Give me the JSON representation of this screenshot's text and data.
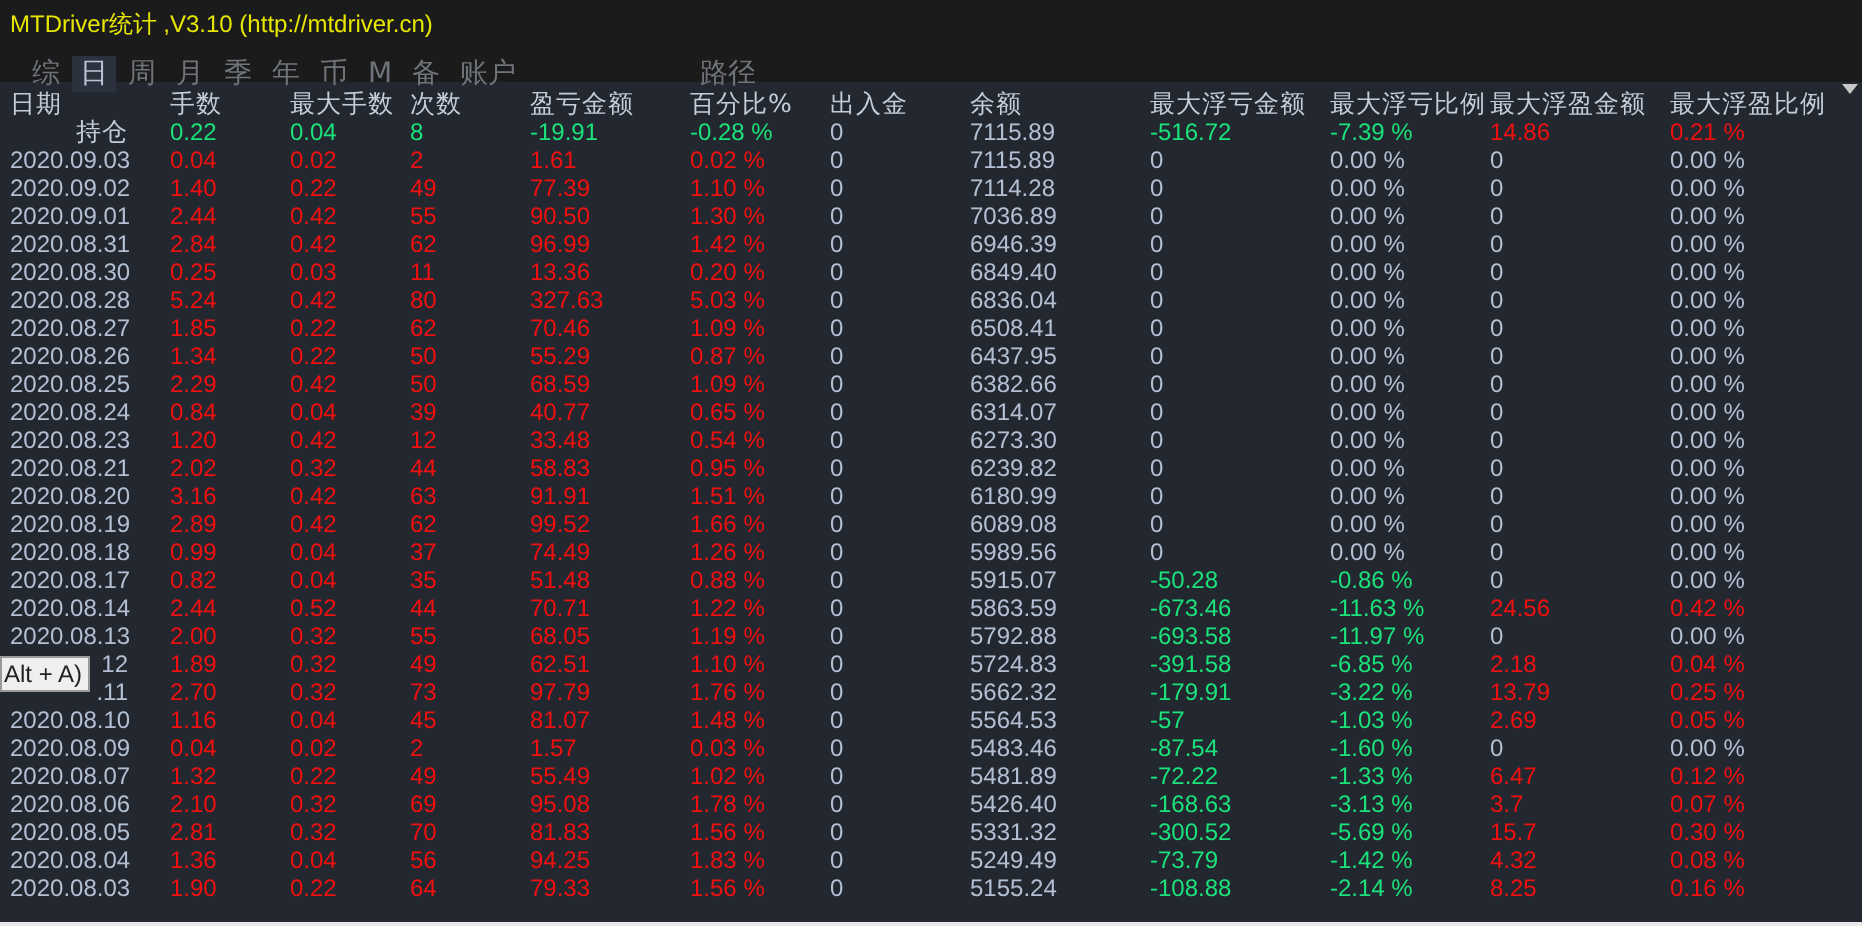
{
  "window": {
    "title": "MTDriver统计 ,V3.10 (http://mtdriver.cn)"
  },
  "tabs": [
    {
      "label": "综",
      "selected": false
    },
    {
      "label": "日",
      "selected": true
    },
    {
      "label": "周",
      "selected": false
    },
    {
      "label": "月",
      "selected": false
    },
    {
      "label": "季",
      "selected": false
    },
    {
      "label": "年",
      "selected": false
    },
    {
      "label": "币",
      "selected": false
    },
    {
      "label": "M",
      "selected": false
    },
    {
      "label": "备",
      "selected": false
    },
    {
      "label": "账户",
      "selected": false
    },
    {
      "label": "路径",
      "selected": false
    }
  ],
  "table": {
    "columns": [
      "日期",
      "手数",
      "最大手数",
      "次数",
      "盈亏金额",
      "百分比%",
      "出入金",
      "余额",
      "最大浮亏金额",
      "最大浮亏比例",
      "最大浮盈金额",
      "最大浮盈比例"
    ],
    "rows": [
      {
        "cells": [
          {
            "text": "持仓"
          },
          {
            "text": "0.22",
            "color": "#1be27a"
          },
          {
            "text": "0.04",
            "color": "#1be27a"
          },
          {
            "text": "8",
            "color": "#1be27a"
          },
          {
            "text": "-19.91",
            "color": "#1be27a"
          },
          {
            "text": "-0.28 %",
            "color": "#1be27a"
          },
          {
            "text": "0"
          },
          {
            "text": "7115.89"
          },
          {
            "text": "-516.72",
            "color": "#1be27a"
          },
          {
            "text": "-7.39 %",
            "color": "#1be27a"
          },
          {
            "text": "14.86",
            "color": "#f01010"
          },
          {
            "text": "0.21 %",
            "color": "#f01010"
          }
        ]
      },
      {
        "cells": [
          {
            "text": "2020.09.03"
          },
          {
            "text": "0.04",
            "color": "#f01010"
          },
          {
            "text": "0.02",
            "color": "#f01010"
          },
          {
            "text": "2",
            "color": "#f01010"
          },
          {
            "text": "1.61",
            "color": "#f01010"
          },
          {
            "text": "0.02 %",
            "color": "#f01010"
          },
          {
            "text": "0"
          },
          {
            "text": "7115.89"
          },
          {
            "text": "0"
          },
          {
            "text": "0.00 %"
          },
          {
            "text": "0"
          },
          {
            "text": "0.00 %"
          }
        ]
      },
      {
        "cells": [
          {
            "text": "2020.09.02"
          },
          {
            "text": "1.40",
            "color": "#f01010"
          },
          {
            "text": "0.22",
            "color": "#f01010"
          },
          {
            "text": "49",
            "color": "#f01010"
          },
          {
            "text": "77.39",
            "color": "#f01010"
          },
          {
            "text": "1.10 %",
            "color": "#f01010"
          },
          {
            "text": "0"
          },
          {
            "text": "7114.28"
          },
          {
            "text": "0"
          },
          {
            "text": "0.00 %"
          },
          {
            "text": "0"
          },
          {
            "text": "0.00 %"
          }
        ]
      },
      {
        "cells": [
          {
            "text": "2020.09.01"
          },
          {
            "text": "2.44",
            "color": "#f01010"
          },
          {
            "text": "0.42",
            "color": "#f01010"
          },
          {
            "text": "55",
            "color": "#f01010"
          },
          {
            "text": "90.50",
            "color": "#f01010"
          },
          {
            "text": "1.30 %",
            "color": "#f01010"
          },
          {
            "text": "0"
          },
          {
            "text": "7036.89"
          },
          {
            "text": "0"
          },
          {
            "text": "0.00 %"
          },
          {
            "text": "0"
          },
          {
            "text": "0.00 %"
          }
        ]
      },
      {
        "cells": [
          {
            "text": "2020.08.31"
          },
          {
            "text": "2.84",
            "color": "#f01010"
          },
          {
            "text": "0.42",
            "color": "#f01010"
          },
          {
            "text": "62",
            "color": "#f01010"
          },
          {
            "text": "96.99",
            "color": "#f01010"
          },
          {
            "text": "1.42 %",
            "color": "#f01010"
          },
          {
            "text": "0"
          },
          {
            "text": "6946.39"
          },
          {
            "text": "0"
          },
          {
            "text": "0.00 %"
          },
          {
            "text": "0"
          },
          {
            "text": "0.00 %"
          }
        ]
      },
      {
        "cells": [
          {
            "text": "2020.08.30"
          },
          {
            "text": "0.25",
            "color": "#f01010"
          },
          {
            "text": "0.03",
            "color": "#f01010"
          },
          {
            "text": "11",
            "color": "#f01010"
          },
          {
            "text": "13.36",
            "color": "#f01010"
          },
          {
            "text": "0.20 %",
            "color": "#f01010"
          },
          {
            "text": "0"
          },
          {
            "text": "6849.40"
          },
          {
            "text": "0"
          },
          {
            "text": "0.00 %"
          },
          {
            "text": "0"
          },
          {
            "text": "0.00 %"
          }
        ]
      },
      {
        "cells": [
          {
            "text": "2020.08.28"
          },
          {
            "text": "5.24",
            "color": "#f01010"
          },
          {
            "text": "0.42",
            "color": "#f01010"
          },
          {
            "text": "80",
            "color": "#f01010"
          },
          {
            "text": "327.63",
            "color": "#f01010"
          },
          {
            "text": "5.03 %",
            "color": "#f01010"
          },
          {
            "text": "0"
          },
          {
            "text": "6836.04"
          },
          {
            "text": "0"
          },
          {
            "text": "0.00 %"
          },
          {
            "text": "0"
          },
          {
            "text": "0.00 %"
          }
        ]
      },
      {
        "cells": [
          {
            "text": "2020.08.27"
          },
          {
            "text": "1.85",
            "color": "#f01010"
          },
          {
            "text": "0.22",
            "color": "#f01010"
          },
          {
            "text": "62",
            "color": "#f01010"
          },
          {
            "text": "70.46",
            "color": "#f01010"
          },
          {
            "text": "1.09 %",
            "color": "#f01010"
          },
          {
            "text": "0"
          },
          {
            "text": "6508.41"
          },
          {
            "text": "0"
          },
          {
            "text": "0.00 %"
          },
          {
            "text": "0"
          },
          {
            "text": "0.00 %"
          }
        ]
      },
      {
        "cells": [
          {
            "text": "2020.08.26"
          },
          {
            "text": "1.34",
            "color": "#f01010"
          },
          {
            "text": "0.22",
            "color": "#f01010"
          },
          {
            "text": "50",
            "color": "#f01010"
          },
          {
            "text": "55.29",
            "color": "#f01010"
          },
          {
            "text": "0.87 %",
            "color": "#f01010"
          },
          {
            "text": "0"
          },
          {
            "text": "6437.95"
          },
          {
            "text": "0"
          },
          {
            "text": "0.00 %"
          },
          {
            "text": "0"
          },
          {
            "text": "0.00 %"
          }
        ]
      },
      {
        "cells": [
          {
            "text": "2020.08.25"
          },
          {
            "text": "2.29",
            "color": "#f01010"
          },
          {
            "text": "0.42",
            "color": "#f01010"
          },
          {
            "text": "50",
            "color": "#f01010"
          },
          {
            "text": "68.59",
            "color": "#f01010"
          },
          {
            "text": "1.09 %",
            "color": "#f01010"
          },
          {
            "text": "0"
          },
          {
            "text": "6382.66"
          },
          {
            "text": "0"
          },
          {
            "text": "0.00 %"
          },
          {
            "text": "0"
          },
          {
            "text": "0.00 %"
          }
        ]
      },
      {
        "cells": [
          {
            "text": "2020.08.24"
          },
          {
            "text": "0.84",
            "color": "#f01010"
          },
          {
            "text": "0.04",
            "color": "#f01010"
          },
          {
            "text": "39",
            "color": "#f01010"
          },
          {
            "text": "40.77",
            "color": "#f01010"
          },
          {
            "text": "0.65 %",
            "color": "#f01010"
          },
          {
            "text": "0"
          },
          {
            "text": "6314.07"
          },
          {
            "text": "0"
          },
          {
            "text": "0.00 %"
          },
          {
            "text": "0"
          },
          {
            "text": "0.00 %"
          }
        ]
      },
      {
        "cells": [
          {
            "text": "2020.08.23"
          },
          {
            "text": "1.20",
            "color": "#f01010"
          },
          {
            "text": "0.42",
            "color": "#f01010"
          },
          {
            "text": "12",
            "color": "#f01010"
          },
          {
            "text": "33.48",
            "color": "#f01010"
          },
          {
            "text": "0.54 %",
            "color": "#f01010"
          },
          {
            "text": "0"
          },
          {
            "text": "6273.30"
          },
          {
            "text": "0"
          },
          {
            "text": "0.00 %"
          },
          {
            "text": "0"
          },
          {
            "text": "0.00 %"
          }
        ]
      },
      {
        "cells": [
          {
            "text": "2020.08.21"
          },
          {
            "text": "2.02",
            "color": "#f01010"
          },
          {
            "text": "0.32",
            "color": "#f01010"
          },
          {
            "text": "44",
            "color": "#f01010"
          },
          {
            "text": "58.83",
            "color": "#f01010"
          },
          {
            "text": "0.95 %",
            "color": "#f01010"
          },
          {
            "text": "0"
          },
          {
            "text": "6239.82"
          },
          {
            "text": "0"
          },
          {
            "text": "0.00 %"
          },
          {
            "text": "0"
          },
          {
            "text": "0.00 %"
          }
        ]
      },
      {
        "cells": [
          {
            "text": "2020.08.20"
          },
          {
            "text": "3.16",
            "color": "#f01010"
          },
          {
            "text": "0.42",
            "color": "#f01010"
          },
          {
            "text": "63",
            "color": "#f01010"
          },
          {
            "text": "91.91",
            "color": "#f01010"
          },
          {
            "text": "1.51 %",
            "color": "#f01010"
          },
          {
            "text": "0"
          },
          {
            "text": "6180.99"
          },
          {
            "text": "0"
          },
          {
            "text": "0.00 %"
          },
          {
            "text": "0"
          },
          {
            "text": "0.00 %"
          }
        ]
      },
      {
        "cells": [
          {
            "text": "2020.08.19"
          },
          {
            "text": "2.89",
            "color": "#f01010"
          },
          {
            "text": "0.42",
            "color": "#f01010"
          },
          {
            "text": "62",
            "color": "#f01010"
          },
          {
            "text": "99.52",
            "color": "#f01010"
          },
          {
            "text": "1.66 %",
            "color": "#f01010"
          },
          {
            "text": "0"
          },
          {
            "text": "6089.08"
          },
          {
            "text": "0"
          },
          {
            "text": "0.00 %"
          },
          {
            "text": "0"
          },
          {
            "text": "0.00 %"
          }
        ]
      },
      {
        "cells": [
          {
            "text": "2020.08.18"
          },
          {
            "text": "0.99",
            "color": "#f01010"
          },
          {
            "text": "0.04",
            "color": "#f01010"
          },
          {
            "text": "37",
            "color": "#f01010"
          },
          {
            "text": "74.49",
            "color": "#f01010"
          },
          {
            "text": "1.26 %",
            "color": "#f01010"
          },
          {
            "text": "0"
          },
          {
            "text": "5989.56"
          },
          {
            "text": "0"
          },
          {
            "text": "0.00 %"
          },
          {
            "text": "0"
          },
          {
            "text": "0.00 %"
          }
        ]
      },
      {
        "cells": [
          {
            "text": "2020.08.17"
          },
          {
            "text": "0.82",
            "color": "#f01010"
          },
          {
            "text": "0.04",
            "color": "#f01010"
          },
          {
            "text": "35",
            "color": "#f01010"
          },
          {
            "text": "51.48",
            "color": "#f01010"
          },
          {
            "text": "0.88 %",
            "color": "#f01010"
          },
          {
            "text": "0"
          },
          {
            "text": "5915.07"
          },
          {
            "text": "-50.28",
            "color": "#1be27a"
          },
          {
            "text": "-0.86 %",
            "color": "#1be27a"
          },
          {
            "text": "0"
          },
          {
            "text": "0.00 %"
          }
        ]
      },
      {
        "cells": [
          {
            "text": "2020.08.14"
          },
          {
            "text": "2.44",
            "color": "#f01010"
          },
          {
            "text": "0.52",
            "color": "#f01010"
          },
          {
            "text": "44",
            "color": "#f01010"
          },
          {
            "text": "70.71",
            "color": "#f01010"
          },
          {
            "text": "1.22 %",
            "color": "#f01010"
          },
          {
            "text": "0"
          },
          {
            "text": "5863.59"
          },
          {
            "text": "-673.46",
            "color": "#1be27a"
          },
          {
            "text": "-11.63 %",
            "color": "#1be27a"
          },
          {
            "text": "24.56",
            "color": "#f01010"
          },
          {
            "text": "0.42 %",
            "color": "#f01010"
          }
        ]
      },
      {
        "cells": [
          {
            "text": "2020.08.13"
          },
          {
            "text": "2.00",
            "color": "#f01010"
          },
          {
            "text": "0.32",
            "color": "#f01010"
          },
          {
            "text": "55",
            "color": "#f01010"
          },
          {
            "text": "68.05",
            "color": "#f01010"
          },
          {
            "text": "1.19 %",
            "color": "#f01010"
          },
          {
            "text": "0"
          },
          {
            "text": "5792.88"
          },
          {
            "text": "-693.58",
            "color": "#1be27a"
          },
          {
            "text": "-11.97 %",
            "color": "#1be27a"
          },
          {
            "text": "0"
          },
          {
            "text": "0.00 %"
          }
        ]
      },
      {
        "cells": [
          {
            "text": "12"
          },
          {
            "text": "1.89",
            "color": "#f01010"
          },
          {
            "text": "0.32",
            "color": "#f01010"
          },
          {
            "text": "49",
            "color": "#f01010"
          },
          {
            "text": "62.51",
            "color": "#f01010"
          },
          {
            "text": "1.10 %",
            "color": "#f01010"
          },
          {
            "text": "0"
          },
          {
            "text": "5724.83"
          },
          {
            "text": "-391.58",
            "color": "#1be27a"
          },
          {
            "text": "-6.85 %",
            "color": "#1be27a"
          },
          {
            "text": "2.18",
            "color": "#f01010"
          },
          {
            "text": "0.04 %",
            "color": "#f01010"
          }
        ]
      },
      {
        "cells": [
          {
            "text": ".11"
          },
          {
            "text": "2.70",
            "color": "#f01010"
          },
          {
            "text": "0.32",
            "color": "#f01010"
          },
          {
            "text": "73",
            "color": "#f01010"
          },
          {
            "text": "97.79",
            "color": "#f01010"
          },
          {
            "text": "1.76 %",
            "color": "#f01010"
          },
          {
            "text": "0"
          },
          {
            "text": "5662.32"
          },
          {
            "text": "-179.91",
            "color": "#1be27a"
          },
          {
            "text": "-3.22 %",
            "color": "#1be27a"
          },
          {
            "text": "13.79",
            "color": "#f01010"
          },
          {
            "text": "0.25 %",
            "color": "#f01010"
          }
        ]
      },
      {
        "cells": [
          {
            "text": "2020.08.10"
          },
          {
            "text": "1.16",
            "color": "#f01010"
          },
          {
            "text": "0.04",
            "color": "#f01010"
          },
          {
            "text": "45",
            "color": "#f01010"
          },
          {
            "text": "81.07",
            "color": "#f01010"
          },
          {
            "text": "1.48 %",
            "color": "#f01010"
          },
          {
            "text": "0"
          },
          {
            "text": "5564.53"
          },
          {
            "text": "-57",
            "color": "#1be27a"
          },
          {
            "text": "-1.03 %",
            "color": "#1be27a"
          },
          {
            "text": "2.69",
            "color": "#f01010"
          },
          {
            "text": "0.05 %",
            "color": "#f01010"
          }
        ]
      },
      {
        "cells": [
          {
            "text": "2020.08.09"
          },
          {
            "text": "0.04",
            "color": "#f01010"
          },
          {
            "text": "0.02",
            "color": "#f01010"
          },
          {
            "text": "2",
            "color": "#f01010"
          },
          {
            "text": "1.57",
            "color": "#f01010"
          },
          {
            "text": "0.03 %",
            "color": "#f01010"
          },
          {
            "text": "0"
          },
          {
            "text": "5483.46"
          },
          {
            "text": "-87.54",
            "color": "#1be27a"
          },
          {
            "text": "-1.60 %",
            "color": "#1be27a"
          },
          {
            "text": "0"
          },
          {
            "text": "0.00 %"
          }
        ]
      },
      {
        "cells": [
          {
            "text": "2020.08.07"
          },
          {
            "text": "1.32",
            "color": "#f01010"
          },
          {
            "text": "0.22",
            "color": "#f01010"
          },
          {
            "text": "49",
            "color": "#f01010"
          },
          {
            "text": "55.49",
            "color": "#f01010"
          },
          {
            "text": "1.02 %",
            "color": "#f01010"
          },
          {
            "text": "0"
          },
          {
            "text": "5481.89"
          },
          {
            "text": "-72.22",
            "color": "#1be27a"
          },
          {
            "text": "-1.33 %",
            "color": "#1be27a"
          },
          {
            "text": "6.47",
            "color": "#f01010"
          },
          {
            "text": "0.12 %",
            "color": "#f01010"
          }
        ]
      },
      {
        "cells": [
          {
            "text": "2020.08.06"
          },
          {
            "text": "2.10",
            "color": "#f01010"
          },
          {
            "text": "0.32",
            "color": "#f01010"
          },
          {
            "text": "69",
            "color": "#f01010"
          },
          {
            "text": "95.08",
            "color": "#f01010"
          },
          {
            "text": "1.78 %",
            "color": "#f01010"
          },
          {
            "text": "0"
          },
          {
            "text": "5426.40"
          },
          {
            "text": "-168.63",
            "color": "#1be27a"
          },
          {
            "text": "-3.13 %",
            "color": "#1be27a"
          },
          {
            "text": "3.7",
            "color": "#f01010"
          },
          {
            "text": "0.07 %",
            "color": "#f01010"
          }
        ]
      },
      {
        "cells": [
          {
            "text": "2020.08.05"
          },
          {
            "text": "2.81",
            "color": "#f01010"
          },
          {
            "text": "0.32",
            "color": "#f01010"
          },
          {
            "text": "70",
            "color": "#f01010"
          },
          {
            "text": "81.83",
            "color": "#f01010"
          },
          {
            "text": "1.56 %",
            "color": "#f01010"
          },
          {
            "text": "0"
          },
          {
            "text": "5331.32"
          },
          {
            "text": "-300.52",
            "color": "#1be27a"
          },
          {
            "text": "-5.69 %",
            "color": "#1be27a"
          },
          {
            "text": "15.7",
            "color": "#f01010"
          },
          {
            "text": "0.30 %",
            "color": "#f01010"
          }
        ]
      },
      {
        "cells": [
          {
            "text": "2020.08.04"
          },
          {
            "text": "1.36",
            "color": "#f01010"
          },
          {
            "text": "0.04",
            "color": "#f01010"
          },
          {
            "text": "56",
            "color": "#f01010"
          },
          {
            "text": "94.25",
            "color": "#f01010"
          },
          {
            "text": "1.83 %",
            "color": "#f01010"
          },
          {
            "text": "0"
          },
          {
            "text": "5249.49"
          },
          {
            "text": "-73.79",
            "color": "#1be27a"
          },
          {
            "text": "-1.42 %",
            "color": "#1be27a"
          },
          {
            "text": "4.32",
            "color": "#f01010"
          },
          {
            "text": "0.08 %",
            "color": "#f01010"
          }
        ]
      },
      {
        "cells": [
          {
            "text": "2020.08.03"
          },
          {
            "text": "1.90",
            "color": "#f01010"
          },
          {
            "text": "0.22",
            "color": "#f01010"
          },
          {
            "text": "64",
            "color": "#f01010"
          },
          {
            "text": "79.33",
            "color": "#f01010"
          },
          {
            "text": "1.56 %",
            "color": "#f01010"
          },
          {
            "text": "0"
          },
          {
            "text": "5155.24"
          },
          {
            "text": "-108.88",
            "color": "#1be27a"
          },
          {
            "text": "-2.14 %",
            "color": "#1be27a"
          },
          {
            "text": "8.25",
            "color": "#f01010"
          },
          {
            "text": "0.16 %",
            "color": "#f01010"
          }
        ]
      }
    ]
  },
  "tooltip": "Alt + A)"
}
